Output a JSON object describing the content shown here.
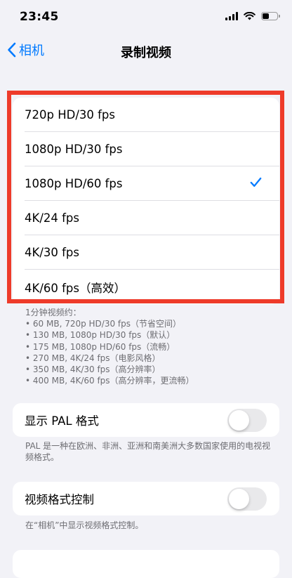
{
  "status_bar": {
    "time": "23:45"
  },
  "nav": {
    "back_label": "相机",
    "title": "录制视频"
  },
  "options": [
    {
      "label": "720p HD/30 fps",
      "selected": false
    },
    {
      "label": "1080p HD/30 fps",
      "selected": false
    },
    {
      "label": "1080p HD/60 fps",
      "selected": true
    },
    {
      "label": "4K/24 fps",
      "selected": false
    },
    {
      "label": "4K/30 fps",
      "selected": false
    },
    {
      "label": "4K/60 fps（高效）",
      "selected": false
    }
  ],
  "size_note": {
    "heading": "1分钟视频约：",
    "lines": [
      "• 60 MB, 720p HD/30 fps（节省空间）",
      "• 130 MB, 1080p HD/30 fps（默认）",
      "• 175 MB, 1080p HD/60 fps（流畅）",
      "• 270 MB, 4K/24 fps（电影风格）",
      "• 350 MB, 4K/30 fps（高分辨率）",
      "• 400 MB, 4K/60 fps（高分辨率，更流畅）"
    ]
  },
  "pal": {
    "label": "显示 PAL 格式",
    "enabled": false,
    "description": "PAL 是一种在欧洲、非洲、亚洲和南美洲大多数国家使用的电视视频格式。"
  },
  "format_control": {
    "label": "视频格式控制",
    "enabled": false,
    "description": "在“相机”中显示视频格式控制。"
  },
  "colors": {
    "accent": "#007aff",
    "highlight_border": "#ee3b2a",
    "background": "#f2f2f7",
    "switch_off": "#e9e9eb"
  },
  "icons": {
    "back": "chevron-left-icon",
    "check": "checkmark-icon",
    "signal": "cellular-signal-icon",
    "wifi": "wifi-icon",
    "battery": "battery-icon"
  }
}
